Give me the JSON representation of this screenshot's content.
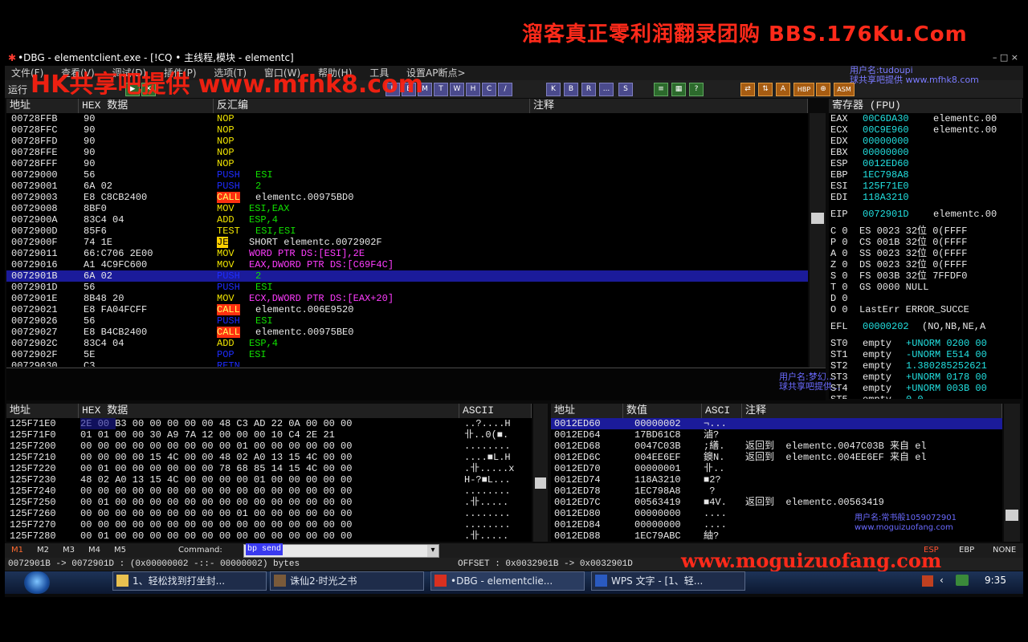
{
  "watermarks": {
    "top": "溜客真正零利润翻录团购 BBS.176Ku.Com",
    "hk": "HK共享吧提供 www.mfhk8.com",
    "bottom": "www.moguizuofang.com",
    "corner_user": "用户名:tudoupi",
    "corner_site": "球共享吧提供 www.mfhk8.com",
    "mid_user": "用户名:梦幻...",
    "mid_site": "球共享吧提供...",
    "mem_user": "用户名:常书般1059072901",
    "mem_site": "www.moguizuofang.com"
  },
  "window": {
    "title": "•DBG - elementclient.exe - [!CQ • 主线程,模块 - elementc]",
    "menu": [
      "文件(F)",
      "查看(V)",
      "调试(D)",
      "插件(P)",
      "选项(T)",
      "窗口(W)",
      "帮助(H)",
      "工具",
      "设置AP断点>"
    ],
    "status_run": "运行",
    "toolbar_letters": [
      "L",
      "E",
      "M",
      "T",
      "W",
      "H",
      "C",
      "/",
      "K",
      "B",
      "R",
      "...",
      "S"
    ]
  },
  "cpu": {
    "headers": {
      "addr": "地址",
      "hex": "HEX 数据",
      "disasm": "反汇编",
      "comment": "注释"
    },
    "rows": [
      {
        "addr": "00728FFB",
        "hex": "90",
        "op": "NOP",
        "arg": "",
        "cls": "nop"
      },
      {
        "addr": "00728FFC",
        "hex": "90",
        "op": "NOP",
        "arg": "",
        "cls": "nop"
      },
      {
        "addr": "00728FFD",
        "hex": "90",
        "op": "NOP",
        "arg": "",
        "cls": "nop"
      },
      {
        "addr": "00728FFE",
        "hex": "90",
        "op": "NOP",
        "arg": "",
        "cls": "nop"
      },
      {
        "addr": "00728FFF",
        "hex": "90",
        "op": "NOP",
        "arg": "",
        "cls": "nop"
      },
      {
        "addr": "00729000",
        "hex": "56",
        "op": "PUSH",
        "arg": "ESI",
        "cls": "push"
      },
      {
        "addr": "00729001",
        "hex": "6A 02",
        "op": "PUSH",
        "arg": "2",
        "cls": "push"
      },
      {
        "addr": "00729003",
        "hex": "E8 C8CB2400",
        "op": "CALL",
        "arg": "elementc.00975BD0",
        "cls": "call"
      },
      {
        "addr": "00729008",
        "hex": "8BF0",
        "op": "MOV",
        "arg": "ESI,EAX",
        "cls": "mov"
      },
      {
        "addr": "0072900A",
        "hex": "83C4 04",
        "op": "ADD",
        "arg": "ESP,4",
        "cls": "add"
      },
      {
        "addr": "0072900D",
        "hex": "85F6",
        "op": "TEST",
        "arg": "ESI,ESI",
        "cls": "test"
      },
      {
        "addr": "0072900F",
        "hex": "74 1E",
        "op": "JE",
        "arg": "SHORT elementc.0072902F",
        "cls": "je"
      },
      {
        "addr": "00729011",
        "hex": "66:C706 2E00",
        "op": "MOV",
        "arg": "WORD PTR DS:[ESI],2E",
        "cls": "movmem"
      },
      {
        "addr": "00729016",
        "hex": "A1 4C9FC600",
        "op": "MOV",
        "arg": "EAX,DWORD PTR DS:[C69F4C]",
        "cls": "movmem"
      },
      {
        "addr": "0072901B",
        "hex": "6A 02",
        "op": "PUSH",
        "arg": "2",
        "cls": "push",
        "selected": true
      },
      {
        "addr": "0072901D",
        "hex": "56",
        "op": "PUSH",
        "arg": "ESI",
        "cls": "push"
      },
      {
        "addr": "0072901E",
        "hex": "8B48 20",
        "op": "MOV",
        "arg": "ECX,DWORD PTR DS:[EAX+20]",
        "cls": "movmem"
      },
      {
        "addr": "00729021",
        "hex": "E8 FA04FCFF",
        "op": "CALL",
        "arg": "elementc.006E9520",
        "cls": "call"
      },
      {
        "addr": "00729026",
        "hex": "56",
        "op": "PUSH",
        "arg": "ESI",
        "cls": "push"
      },
      {
        "addr": "00729027",
        "hex": "E8 B4CB2400",
        "op": "CALL",
        "arg": "elementc.00975BE0",
        "cls": "call"
      },
      {
        "addr": "0072902C",
        "hex": "83C4 04",
        "op": "ADD",
        "arg": "ESP,4",
        "cls": "add"
      },
      {
        "addr": "0072902F",
        "hex": "5E",
        "op": "POP",
        "arg": "ESI",
        "cls": "push"
      },
      {
        "addr": "00729030",
        "hex": "C3",
        "op": "RETN",
        "arg": "",
        "cls": "retn"
      }
    ]
  },
  "registers": {
    "header": "寄存器 (FPU)",
    "gp": [
      {
        "name": "EAX",
        "val": "00C6DA30",
        "note": "elementc.00"
      },
      {
        "name": "ECX",
        "val": "00C9E960",
        "note": "elementc.00"
      },
      {
        "name": "EDX",
        "val": "00000000",
        "note": ""
      },
      {
        "name": "EBX",
        "val": "00000000",
        "note": ""
      },
      {
        "name": "ESP",
        "val": "0012ED60",
        "note": ""
      },
      {
        "name": "EBP",
        "val": "1EC798A8",
        "note": ""
      },
      {
        "name": "ESI",
        "val": "125F71E0",
        "note": ""
      },
      {
        "name": "EDI",
        "val": "118A3210",
        "note": ""
      }
    ],
    "eip": {
      "name": "EIP",
      "val": "0072901D",
      "note": "elementc.00"
    },
    "flags": [
      "C 0  ES 0023 32位 0(FFFF",
      "P 0  CS 001B 32位 0(FFFF",
      "A 0  SS 0023 32位 0(FFFF",
      "Z 0  DS 0023 32位 0(FFFF",
      "S 0  FS 003B 32位 7FFDF0",
      "T 0  GS 0000 NULL",
      "D 0",
      "O 0  LastErr ERROR_SUCCE"
    ],
    "efl": {
      "name": "EFL",
      "val": "00000202",
      "note": "(NO,NB,NE,A"
    },
    "fpu": [
      {
        "name": "ST0",
        "state": "empty",
        "val": "+UNORM 0200 00"
      },
      {
        "name": "ST1",
        "state": "empty",
        "val": "-UNORM E514 00"
      },
      {
        "name": "ST2",
        "state": "empty",
        "val": "1.380285252621"
      },
      {
        "name": "ST3",
        "state": "empty",
        "val": "+UNORM 0178 00"
      },
      {
        "name": "ST4",
        "state": "empty",
        "val": "+UNORM 003B 00"
      },
      {
        "name": "ST5",
        "state": "empty",
        "val": "0.0"
      }
    ]
  },
  "dump": {
    "headers": {
      "addr": "地址",
      "hex": "HEX 数据",
      "ascii": "ASCII"
    },
    "rows": [
      {
        "addr": "125F71E0",
        "hex": "2E 00 B3 00 00 00 00 00 48 C3 AD 22 0A 00 00 00",
        "ascii": "..?....H"
      },
      {
        "addr": "125F71F0",
        "hex": "01 01 00 00 30 A9 7A 12 00 00 00 10 C4 2E 21",
        "ascii": "卝..0(■."
      },
      {
        "addr": "125F7200",
        "hex": "00 00 00 00 00 00 00 00 00 01 00 00 00 00 00 00",
        "ascii": "........"
      },
      {
        "addr": "125F7210",
        "hex": "00 00 00 00 15 4C 00 00 48 02 A0 13 15 4C 00 00",
        "ascii": "....■L.H"
      },
      {
        "addr": "125F7220",
        "hex": "00 01 00 00 00 00 00 00 78 68 85 14 15 4C 00 00",
        "ascii": ".卝.....x"
      },
      {
        "addr": "125F7230",
        "hex": "48 02 A0 13 15 4C 00 00 00 00 01 00 00 00 00 00",
        "ascii": "H-?■L..."
      },
      {
        "addr": "125F7240",
        "hex": "00 00 00 00 00 00 00 00 00 00 00 00 00 00 00 00",
        "ascii": "........"
      },
      {
        "addr": "125F7250",
        "hex": "00 01 00 00 00 00 00 00 00 00 00 00 00 00 00 00",
        "ascii": ".卝....."
      },
      {
        "addr": "125F7260",
        "hex": "00 00 00 00 00 00 00 00 00 01 00 00 00 00 00 00",
        "ascii": "........"
      },
      {
        "addr": "125F7270",
        "hex": "00 00 00 00 00 00 00 00 00 00 00 00 00 00 00 00",
        "ascii": "........"
      },
      {
        "addr": "125F7280",
        "hex": "00 01 00 00 00 00 00 00 00 00 00 00 00 00 00 00",
        "ascii": ".卝....."
      }
    ]
  },
  "stack": {
    "headers": {
      "addr": "地址",
      "val": "数值",
      "ascii": "ASCI",
      "comment": "注释"
    },
    "rows": [
      {
        "addr": "0012ED60",
        "val": "00000002",
        "ascii": "¬...",
        "comment": "",
        "selected": true
      },
      {
        "addr": "0012ED64",
        "val": "17BD61C8",
        "ascii": "滷?",
        "comment": ""
      },
      {
        "addr": "0012ED68",
        "val": "0047C03B",
        "ascii": ";繕.",
        "comment": "返回到  elementc.0047C03B 来自 el"
      },
      {
        "addr": "0012ED6C",
        "val": "004EE6EF",
        "ascii": "鐭N.",
        "comment": "返回到  elementc.004EE6EF 来自 el"
      },
      {
        "addr": "0012ED70",
        "val": "00000001",
        "ascii": "卝..",
        "comment": ""
      },
      {
        "addr": "0012ED74",
        "val": "118A3210",
        "ascii": "■2?",
        "comment": ""
      },
      {
        "addr": "0012ED78",
        "val": "1EC798A8",
        "ascii": " ?",
        "comment": ""
      },
      {
        "addr": "0012ED7C",
        "val": "00563419",
        "ascii": "■4V.",
        "comment": "返回到  elementc.00563419"
      },
      {
        "addr": "0012ED80",
        "val": "00000000",
        "ascii": "....",
        "comment": ""
      },
      {
        "addr": "0012ED84",
        "val": "00000000",
        "ascii": "....",
        "comment": ""
      },
      {
        "addr": "0012ED88",
        "val": "1EC79ABC",
        "ascii": "紬?",
        "comment": ""
      }
    ]
  },
  "command": {
    "m_buttons": [
      "M1",
      "M2",
      "M3",
      "M4",
      "M5"
    ],
    "label": "Command:",
    "value": "bp send",
    "right": [
      "ESP",
      "EBP",
      "NONE"
    ]
  },
  "status": {
    "left": "0072901B -> 0072901D : (0x00000002  -::-    00000002) bytes",
    "right": "OFFSET : 0x0032901B -> 0x0032901D"
  },
  "taskbar": {
    "items": [
      {
        "label": "1、轻松找到打坐封..."
      },
      {
        "label": "诛仙2·时光之书"
      },
      {
        "label": "•DBG - elementclie..."
      },
      {
        "label": "WPS 文字 - [1、轻..."
      }
    ],
    "time": "9:35"
  },
  "colors": {
    "selection": "#1b1b9a",
    "call_bg": "#ff3010",
    "je_bg": "#ffd000",
    "push": "#1e2cff",
    "operand": "#11e000",
    "mem": "#ff3cff"
  }
}
